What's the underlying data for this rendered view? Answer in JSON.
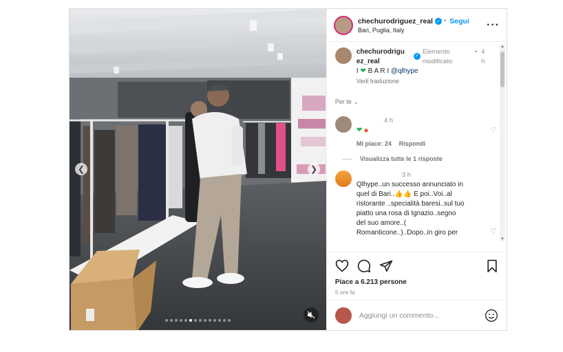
{
  "header": {
    "username": "chechurodriguez_real",
    "follow_label": "Segui",
    "location": "Bari, Puglia, Italy"
  },
  "caption": {
    "username_line1": "chechurodrigu",
    "username_line2": "ez_real",
    "edited_label": "Elemento modificato",
    "time_dot": "•",
    "time_line1": "4",
    "time_line2": "h",
    "text_prefix": "I",
    "text_middle": "B A R I",
    "mention": "@qlhype",
    "translate_label": "Vedi traduzione"
  },
  "filter": {
    "label": "Per te"
  },
  "comment1": {
    "time": "4 h",
    "likes": "Mi piace: 24",
    "reply_label": "Rispondi",
    "view_replies": "Visualizza tutte le 1 risposte"
  },
  "comment2": {
    "time": "3 h",
    "lines": [
      "Qlhype..un successo annunciato in",
      "quel di Bari..👍👍 E poi..Voi..al",
      "ristorante ..specialità baresi..sul tuo",
      "piatto una rosa di Ignazio..segno",
      "del suo amore..(",
      "Romanticone..)..Dopo..in giro per"
    ]
  },
  "actions": {
    "likes": "Piace a 6.213 persone",
    "time": "5 ore fa"
  },
  "add_comment": {
    "placeholder": "Aggiungi un commento..."
  },
  "icons": [
    "chevron-left-icon",
    "chevron-right-icon",
    "mute-icon",
    "more-icon",
    "verified-icon",
    "heart-icon",
    "comment-icon",
    "share-icon",
    "bookmark-icon",
    "emoji-icon"
  ],
  "colors": {
    "link_blue": "#0095f6",
    "text": "#262626",
    "secondary": "#8e8e8e"
  }
}
